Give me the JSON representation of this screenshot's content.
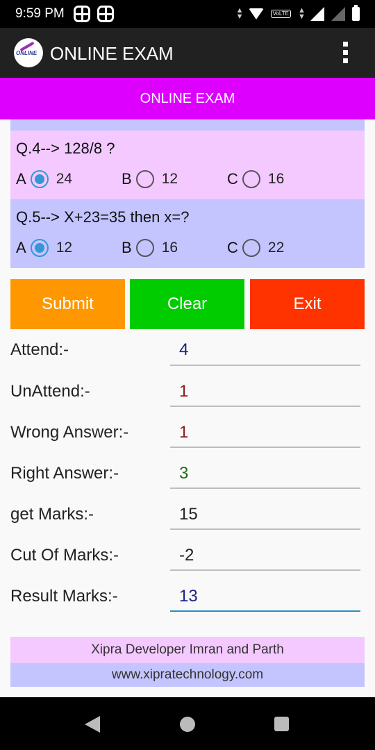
{
  "status_bar": {
    "time": "9:59 PM",
    "network_badge": "VoLTE"
  },
  "app_bar": {
    "title": "ONLINE EXAM",
    "logo_text": "ONLINE",
    "menu_icon": "more-vert-icon"
  },
  "header": {
    "title": "ONLINE EXAM"
  },
  "questions": [
    {
      "text": "Q.4--> 128/8 ?",
      "options": [
        {
          "letter": "A",
          "value": "24",
          "checked": true
        },
        {
          "letter": "B",
          "value": "12",
          "checked": false
        },
        {
          "letter": "C",
          "value": "16",
          "checked": false
        }
      ],
      "background": "#f3c9ff"
    },
    {
      "text": "Q.5--> X+23=35 then x=?",
      "options": [
        {
          "letter": "A",
          "value": "12",
          "checked": true
        },
        {
          "letter": "B",
          "value": "16",
          "checked": false
        },
        {
          "letter": "C",
          "value": "22",
          "checked": false
        }
      ],
      "background": "#c4c4ff"
    }
  ],
  "buttons": {
    "submit": {
      "label": "Submit",
      "color": "#ff9800"
    },
    "clear": {
      "label": "Clear",
      "color": "#00cc00"
    },
    "exit": {
      "label": "Exit",
      "color": "#ff3300"
    }
  },
  "stats": [
    {
      "label": "Attend:-",
      "value": "4",
      "color": "#1a237e"
    },
    {
      "label": "UnAttend:-",
      "value": "1",
      "color": "#8b1a1a"
    },
    {
      "label": "Wrong Answer:-",
      "value": "1",
      "color": "#8b1a1a"
    },
    {
      "label": "Right Answer:-",
      "value": "3",
      "color": "#1b6e1b"
    },
    {
      "label": "get Marks:-",
      "value": "15",
      "color": "#222222"
    },
    {
      "label": "Cut Of Marks:-",
      "value": "-2",
      "color": "#222222"
    },
    {
      "label": "Result Marks:-",
      "value": "13",
      "color": "#1a237e"
    }
  ],
  "footer": {
    "credit": "Xipra Developer Imran and Parth",
    "website": "www.xipratechnology.com"
  }
}
